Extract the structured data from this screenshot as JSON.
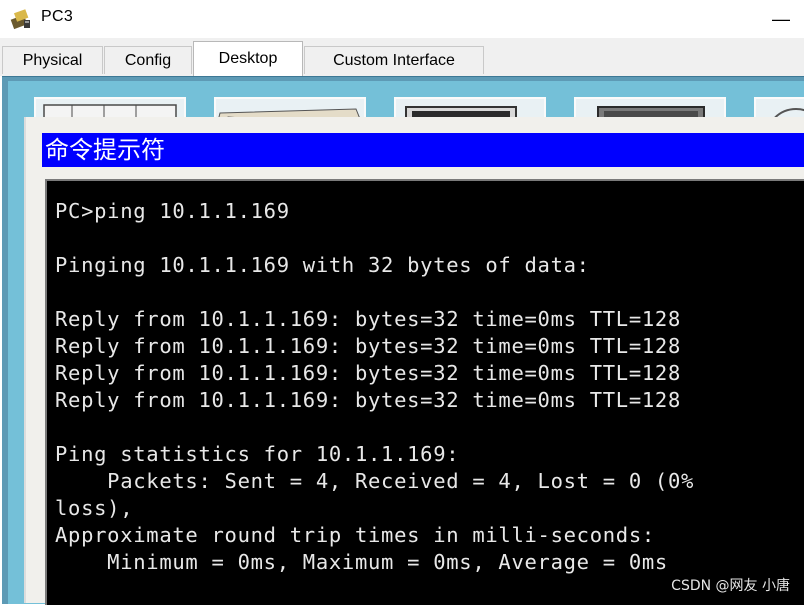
{
  "window": {
    "title": "PC3",
    "minimize_label": "—"
  },
  "tabs": [
    {
      "label": "Physical",
      "active": false
    },
    {
      "label": "Config",
      "active": false
    },
    {
      "label": "Desktop",
      "active": true
    },
    {
      "label": "Custom Interface",
      "active": false
    }
  ],
  "command_prompt": {
    "title": "命令提示符",
    "lines": [
      "PC>ping 10.1.1.169",
      "",
      "Pinging 10.1.1.169 with 32 bytes of data:",
      "",
      "Reply from 10.1.1.169: bytes=32 time=0ms TTL=128",
      "Reply from 10.1.1.169: bytes=32 time=0ms TTL=128",
      "Reply from 10.1.1.169: bytes=32 time=0ms TTL=128",
      "Reply from 10.1.1.169: bytes=32 time=0ms TTL=128",
      "",
      "Ping statistics for 10.1.1.169:",
      "    Packets: Sent = 4, Received = 4, Lost = 0 (0%",
      "loss),",
      "Approximate round trip times in milli-seconds:",
      "    Minimum = 0ms, Maximum = 0ms, Average = 0ms"
    ]
  },
  "watermark": "CSDN @网友 小唐",
  "colors": {
    "cmd_titlebar": "#0000ff",
    "terminal_bg": "#000000",
    "terminal_text": "#e8e8e8",
    "desktop_bg": "#74c0d8"
  }
}
